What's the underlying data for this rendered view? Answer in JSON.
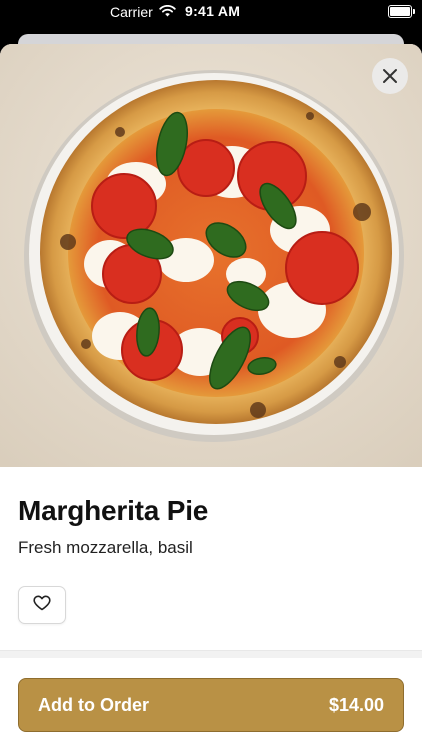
{
  "status_bar": {
    "carrier": "Carrier",
    "time": "9:41 AM",
    "icons": [
      "wifi-icon",
      "battery-icon"
    ]
  },
  "product": {
    "name": "Margherita Pie",
    "description": "Fresh mozzarella, basil",
    "image_alt": "Margherita pizza with tomatoes, mozzarella and basil"
  },
  "actions": {
    "close_icon": "close-icon",
    "favorite_icon": "heart-outline-icon",
    "add_to_order_label": "Add to Order",
    "price": "$14.00"
  },
  "colors": {
    "accent": "#b99145",
    "accent_border": "#8f6d2e",
    "text_primary": "#111111",
    "background": "#ffffff"
  }
}
